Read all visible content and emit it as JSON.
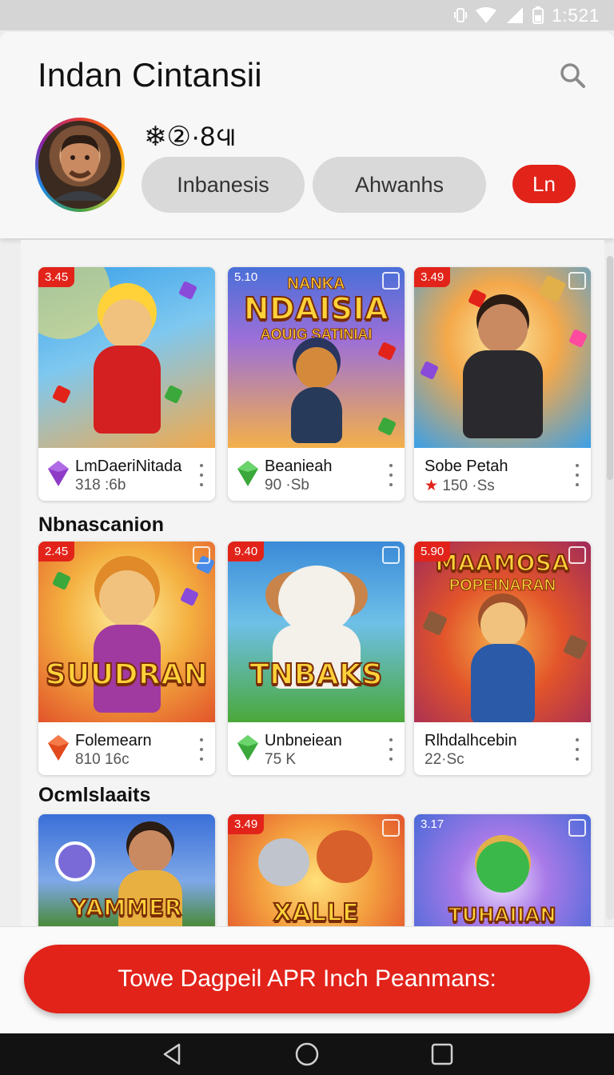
{
  "status_bar": {
    "time": "1:521",
    "icons": [
      "vibrate-icon",
      "wifi-icon",
      "signal-icon",
      "battery-icon"
    ]
  },
  "header": {
    "title": "Indan Cintansii",
    "search_icon": "search-icon",
    "profile_stat": "❄②·8᪫",
    "pills": [
      "Inbanesis",
      "Ahwanhs"
    ],
    "lang_button": "Ln"
  },
  "sections": [
    {
      "title": "",
      "cards": [
        {
          "price": "3.45",
          "art_title": "",
          "art_subtitle": "",
          "name": "LmDaeriNitada",
          "meta": "318 :6b",
          "gem_color": "#8e3cc8"
        },
        {
          "price": "5.10",
          "art_title": "NDAISIA",
          "art_top": "NANKA",
          "art_subtitle": "AOUIG SATINIAI",
          "name": "Beanieah",
          "meta": "90 ·Sb",
          "gem_color": "#3aa83a"
        },
        {
          "price": "3.49",
          "art_title": "",
          "art_subtitle": "",
          "name": "Sobe Petah",
          "meta": "150 ·Ss",
          "gem_color": "#e2231a"
        }
      ]
    },
    {
      "title": "Nbnascanion",
      "cards": [
        {
          "price": "2.45",
          "art_title": "SUUDRAN",
          "art_subtitle": "",
          "name": "Folemearn",
          "meta": "810 16c",
          "gem_color": "#e04a1c"
        },
        {
          "price": "9.40",
          "art_title": "TNBAKS",
          "art_subtitle": "",
          "name": "Unbneiean",
          "meta": "75  K",
          "gem_color": "#3aa83a"
        },
        {
          "price": "5.90",
          "art_title": "MAAMOSA",
          "art_subtitle": "POPEINARAN",
          "name": "Rlhdalhcebin",
          "meta": "22·Sc",
          "gem_color": ""
        }
      ]
    },
    {
      "title": "Ocmlslaaits",
      "cards": [
        {
          "price": "",
          "art_title": "YAMMER",
          "art_subtitle": ""
        },
        {
          "price": "3.49",
          "art_title": "XALLE",
          "art_subtitle": ""
        },
        {
          "price": "3.17",
          "art_title": "TUHAIIAN",
          "art_subtitle": ""
        }
      ]
    }
  ],
  "cta": {
    "label": "Towe Dagpeil APR Inch Peanmans:"
  },
  "nav": {
    "icons": [
      "back-icon",
      "home-icon",
      "recents-icon"
    ]
  },
  "colors": {
    "accent": "#e2231a",
    "background": "#eeeeee",
    "pill": "#d9d9d9"
  }
}
